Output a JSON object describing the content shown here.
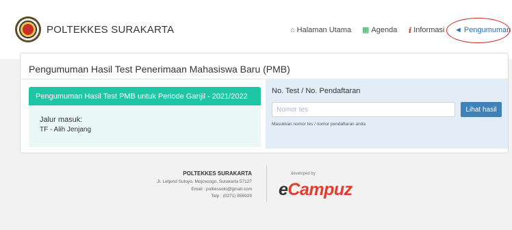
{
  "header": {
    "brand": "POLTEKKES SURAKARTA",
    "nav": [
      {
        "label": "Halaman Utama",
        "icon": "home-icon"
      },
      {
        "label": "Agenda",
        "icon": "calendar-icon"
      },
      {
        "label": "Informasi",
        "icon": "info-icon"
      },
      {
        "label": "Pengumuman",
        "icon": "bullhorn-icon"
      }
    ]
  },
  "main": {
    "title": "Pengumuman Hasil Test Penerimaan Mahasiswa Baru (PMB)",
    "period": {
      "heading": "Pengumuman Hasil Test PMB untuk Periode Ganjil - 2021/2022",
      "jalur_label": "Jalur masuk:",
      "jalur_value": "TF - Alih Jenjang"
    },
    "search": {
      "label": "No. Test / No. Pendaftaran",
      "placeholder": "Nomor tes",
      "button": "Lihat hasil",
      "hint": "Masukkan nomor tes / nomor pendaftaran anda"
    }
  },
  "footer": {
    "name": "POLTEKKES SURAKARTA",
    "address": "Jl. Letjend Sutoyo, Mojosongo, Surakarta 57127",
    "email": "Email : polkessolo@gmail.com",
    "phone": "Telp : (0271) 856929",
    "developed_by": "developed by",
    "brand_e": "e",
    "brand_rest": "Campuz"
  },
  "colors": {
    "accent": "#1ec6a6",
    "button": "#3f82b8",
    "highlight_circle": "#d0221d"
  }
}
